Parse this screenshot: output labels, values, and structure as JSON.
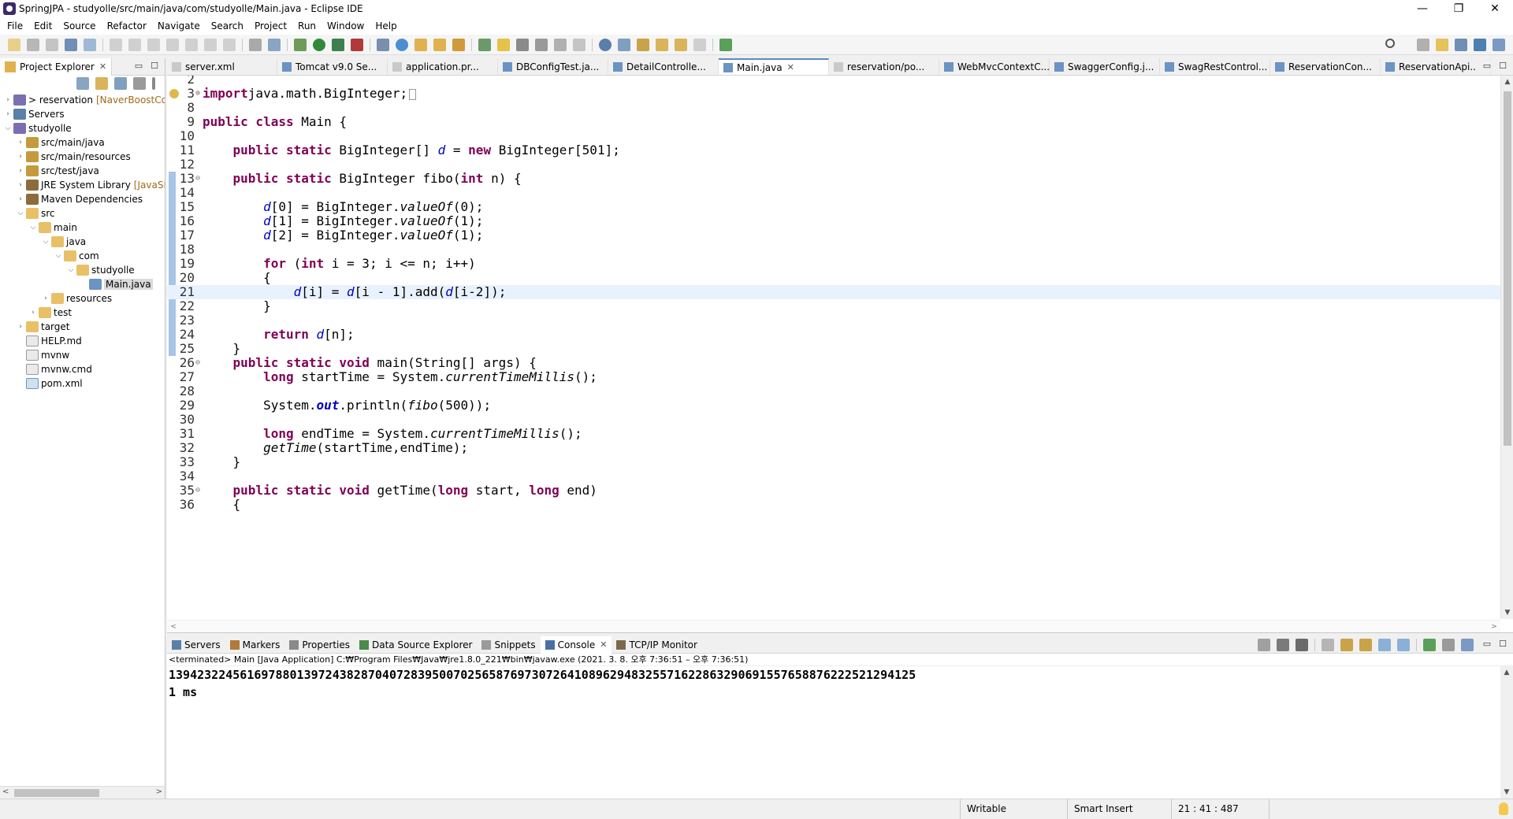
{
  "window": {
    "title": "SpringJPA - studyolle/src/main/java/com/studyolle/Main.java - Eclipse IDE"
  },
  "menu": [
    "File",
    "Edit",
    "Source",
    "Refactor",
    "Navigate",
    "Search",
    "Project",
    "Run",
    "Window",
    "Help"
  ],
  "project_explorer": {
    "title": "Project Explorer",
    "tree": [
      {
        "depth": 0,
        "twisty": ">",
        "icon": "project",
        "label": "> reservation",
        "decoration": "[NaverBoostCour"
      },
      {
        "depth": 0,
        "twisty": ">",
        "icon": "server",
        "label": "Servers"
      },
      {
        "depth": 0,
        "twisty": "v",
        "icon": "project",
        "label": "studyolle"
      },
      {
        "depth": 1,
        "twisty": ">",
        "icon": "srcfolder",
        "label": "src/main/java"
      },
      {
        "depth": 1,
        "twisty": ">",
        "icon": "srcfolder",
        "label": "src/main/resources"
      },
      {
        "depth": 1,
        "twisty": ">",
        "icon": "srcfolder",
        "label": "src/test/java"
      },
      {
        "depth": 1,
        "twisty": ">",
        "icon": "lib",
        "label": "JRE System Library",
        "decoration": "[JavaSE-"
      },
      {
        "depth": 1,
        "twisty": ">",
        "icon": "lib",
        "label": "Maven Dependencies"
      },
      {
        "depth": 1,
        "twisty": "v",
        "icon": "folder",
        "label": "src"
      },
      {
        "depth": 2,
        "twisty": "v",
        "icon": "folder",
        "label": "main"
      },
      {
        "depth": 3,
        "twisty": "v",
        "icon": "folder",
        "label": "java"
      },
      {
        "depth": 4,
        "twisty": "v",
        "icon": "folder",
        "label": "com"
      },
      {
        "depth": 5,
        "twisty": "v",
        "icon": "folder",
        "label": "studyolle"
      },
      {
        "depth": 6,
        "twisty": "",
        "icon": "java",
        "label": "Main.java",
        "selected": true
      },
      {
        "depth": 3,
        "twisty": ">",
        "icon": "folder",
        "label": "resources"
      },
      {
        "depth": 2,
        "twisty": ">",
        "icon": "folder",
        "label": "test"
      },
      {
        "depth": 1,
        "twisty": ">",
        "icon": "folder",
        "label": "target"
      },
      {
        "depth": 1,
        "twisty": "",
        "icon": "file",
        "label": "HELP.md"
      },
      {
        "depth": 1,
        "twisty": "",
        "icon": "file",
        "label": "mvnw"
      },
      {
        "depth": 1,
        "twisty": "",
        "icon": "file",
        "label": "mvnw.cmd"
      },
      {
        "depth": 1,
        "twisty": "",
        "icon": "xml",
        "label": "pom.xml"
      }
    ]
  },
  "editor": {
    "tabs": [
      {
        "label": "server.xml",
        "active": false
      },
      {
        "label": "Tomcat v9.0 Se...",
        "active": false
      },
      {
        "label": "application.pr...",
        "active": false
      },
      {
        "label": "DBConfigTest.ja...",
        "active": false
      },
      {
        "label": "DetailControlle...",
        "active": false
      },
      {
        "label": "Main.java",
        "active": true
      },
      {
        "label": "reservation/po...",
        "active": false
      },
      {
        "label": "WebMvcContextC...",
        "active": false
      },
      {
        "label": "SwaggerConfig.j...",
        "active": false
      },
      {
        "label": "SwagRestControl...",
        "active": false
      },
      {
        "label": "ReservationCon...",
        "active": false
      },
      {
        "label": "ReservationApi...",
        "active": false
      }
    ],
    "current_line": 21,
    "lines": [
      {
        "n": "2",
        "fold": "",
        "tokens": []
      },
      {
        "n": "3",
        "fold": "⊕",
        "tokens": [
          [
            "kw",
            "import"
          ],
          [
            "",
            "java.math.BigInteger;"
          ]
        ],
        "collapsed": true
      },
      {
        "n": "8",
        "fold": "",
        "tokens": []
      },
      {
        "n": "9",
        "fold": "",
        "tokens": [
          [
            "kw",
            "public class"
          ],
          [
            "",
            " Main {"
          ]
        ]
      },
      {
        "n": "10",
        "fold": "",
        "tokens": []
      },
      {
        "n": "11",
        "fold": "",
        "tokens": [
          [
            "",
            "    "
          ],
          [
            "kw",
            "public static"
          ],
          [
            "",
            " BigInteger[] "
          ],
          [
            "fld",
            "d"
          ],
          [
            "",
            " = "
          ],
          [
            "kw",
            "new"
          ],
          [
            "",
            " BigInteger[501];"
          ]
        ]
      },
      {
        "n": "12",
        "fold": "",
        "tokens": []
      },
      {
        "n": "13",
        "fold": "⊖",
        "tokens": [
          [
            "",
            "    "
          ],
          [
            "kw",
            "public static"
          ],
          [
            "",
            " BigInteger fibo("
          ],
          [
            "kw",
            "int"
          ],
          [
            "",
            " n) {"
          ]
        ]
      },
      {
        "n": "14",
        "fold": "",
        "tokens": []
      },
      {
        "n": "15",
        "fold": "",
        "tokens": [
          [
            "",
            "        "
          ],
          [
            "fld",
            "d"
          ],
          [
            "",
            "[0] = BigInteger."
          ],
          [
            "st",
            "valueOf"
          ],
          [
            "",
            "(0);"
          ]
        ]
      },
      {
        "n": "16",
        "fold": "",
        "tokens": [
          [
            "",
            "        "
          ],
          [
            "fld",
            "d"
          ],
          [
            "",
            "[1] = BigInteger."
          ],
          [
            "st",
            "valueOf"
          ],
          [
            "",
            "(1);"
          ]
        ]
      },
      {
        "n": "17",
        "fold": "",
        "tokens": [
          [
            "",
            "        "
          ],
          [
            "fld",
            "d"
          ],
          [
            "",
            "[2] = BigInteger."
          ],
          [
            "st",
            "valueOf"
          ],
          [
            "",
            "(1);"
          ]
        ]
      },
      {
        "n": "18",
        "fold": "",
        "tokens": []
      },
      {
        "n": "19",
        "fold": "",
        "tokens": [
          [
            "",
            "        "
          ],
          [
            "kw",
            "for"
          ],
          [
            "",
            " ("
          ],
          [
            "kw",
            "int"
          ],
          [
            "",
            " i = 3; i <= n; i++)"
          ]
        ]
      },
      {
        "n": "20",
        "fold": "",
        "tokens": [
          [
            "",
            "        {"
          ]
        ]
      },
      {
        "n": "21",
        "fold": "",
        "tokens": [
          [
            "",
            "            "
          ],
          [
            "fld",
            "d"
          ],
          [
            "",
            "[i] = "
          ],
          [
            "fld",
            "d"
          ],
          [
            "",
            "[i - 1].add("
          ],
          [
            "fld",
            "d"
          ],
          [
            "",
            "[i-2]);"
          ]
        ]
      },
      {
        "n": "22",
        "fold": "",
        "tokens": [
          [
            "",
            "        }"
          ]
        ]
      },
      {
        "n": "23",
        "fold": "",
        "tokens": []
      },
      {
        "n": "24",
        "fold": "",
        "tokens": [
          [
            "",
            "        "
          ],
          [
            "kw",
            "return"
          ],
          [
            "",
            " "
          ],
          [
            "fld",
            "d"
          ],
          [
            "",
            "[n];"
          ]
        ]
      },
      {
        "n": "25",
        "fold": "",
        "tokens": [
          [
            "",
            "    }"
          ]
        ]
      },
      {
        "n": "26",
        "fold": "⊖",
        "tokens": [
          [
            "",
            "    "
          ],
          [
            "kw",
            "public static void"
          ],
          [
            "",
            " main(String[] args) {"
          ]
        ]
      },
      {
        "n": "27",
        "fold": "",
        "tokens": [
          [
            "",
            "        "
          ],
          [
            "kw",
            "long"
          ],
          [
            "",
            " startTime = System."
          ],
          [
            "st",
            "currentTimeMillis"
          ],
          [
            "",
            "();"
          ]
        ]
      },
      {
        "n": "28",
        "fold": "",
        "tokens": []
      },
      {
        "n": "29",
        "fold": "",
        "tokens": [
          [
            "",
            "        System."
          ],
          [
            "stfld",
            "out"
          ],
          [
            "",
            ".println("
          ],
          [
            "st",
            "fibo"
          ],
          [
            "",
            "(500));"
          ]
        ]
      },
      {
        "n": "30",
        "fold": "",
        "tokens": []
      },
      {
        "n": "31",
        "fold": "",
        "tokens": [
          [
            "",
            "        "
          ],
          [
            "kw",
            "long"
          ],
          [
            "",
            " endTime = System."
          ],
          [
            "st",
            "currentTimeMillis"
          ],
          [
            "",
            "();"
          ]
        ]
      },
      {
        "n": "32",
        "fold": "",
        "tokens": [
          [
            "",
            "        "
          ],
          [
            "st",
            "getTime"
          ],
          [
            "",
            "(startTime,endTime);"
          ]
        ]
      },
      {
        "n": "33",
        "fold": "",
        "tokens": [
          [
            "",
            "    }"
          ]
        ]
      },
      {
        "n": "34",
        "fold": "",
        "tokens": []
      },
      {
        "n": "35",
        "fold": "⊖",
        "tokens": [
          [
            "",
            "    "
          ],
          [
            "kw",
            "public static void"
          ],
          [
            "",
            " getTime("
          ],
          [
            "kw",
            "long"
          ],
          [
            "",
            " start, "
          ],
          [
            "kw",
            "long"
          ],
          [
            "",
            " end)"
          ]
        ]
      },
      {
        "n": "36",
        "fold": "",
        "tokens": [
          [
            "",
            "    {"
          ]
        ]
      }
    ]
  },
  "bottom": {
    "tabs": [
      {
        "label": "Servers",
        "active": false
      },
      {
        "label": "Markers",
        "active": false
      },
      {
        "label": "Properties",
        "active": false
      },
      {
        "label": "Data Source Explorer",
        "active": false
      },
      {
        "label": "Snippets",
        "active": false
      },
      {
        "label": "Console",
        "active": true
      },
      {
        "label": "TCP/IP Monitor",
        "active": false
      }
    ],
    "console_description": "<terminated> Main [Java Application] C:₩Program Files₩Java₩jre1.8.0_221₩bin₩javaw.exe  (2021. 3. 8. 오후 7:36:51 – 오후 7:36:51)",
    "console_output": [
      "139423224561697880139724382870407283950070256587697307264108962948325571622863290691557658876222521294125",
      "1 ms"
    ]
  },
  "status": {
    "writable": "Writable",
    "insert_mode": "Smart Insert",
    "position": "21 : 41 : 487"
  },
  "colors": {
    "keyword": "#7f0055",
    "field": "#0000c0",
    "current_line": "#e8f2fe",
    "accent": "#5a8ac6"
  }
}
